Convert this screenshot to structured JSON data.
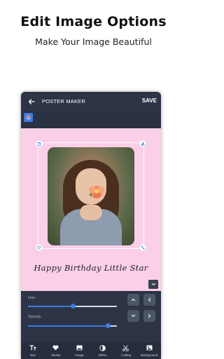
{
  "promo": {
    "headline": "Edit Image Options",
    "subline": "Make Your Image Beautiful"
  },
  "app": {
    "title": "POSTER MAKER",
    "save_label": "SAVE",
    "accent_color": "#3d7be0",
    "bar_color": "#2c3446"
  },
  "canvas": {
    "background_color": "#fbcfe8",
    "caption": "Happy Birthday Little Star"
  },
  "controls": {
    "hue_label": "Hue",
    "hue_value": 0.5,
    "opacity_label": "Opacity",
    "opacity_value": 0.9
  },
  "bottom_nav": {
    "items": [
      {
        "label": "Text",
        "icon": "text-icon"
      },
      {
        "label": "Sticker",
        "icon": "heart-icon"
      },
      {
        "label": "Image",
        "icon": "image-icon"
      },
      {
        "label": "Effect",
        "icon": "contrast-icon"
      },
      {
        "label": "Cutting",
        "icon": "cut-icon"
      },
      {
        "label": "Background",
        "icon": "background-icon"
      }
    ]
  }
}
